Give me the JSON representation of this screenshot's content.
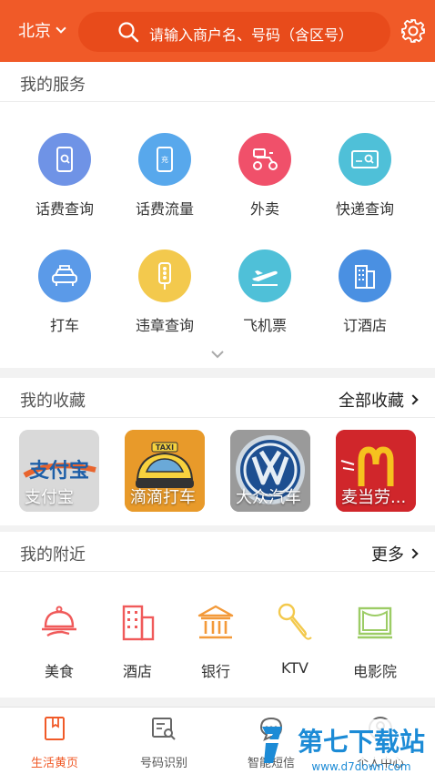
{
  "header": {
    "city": "北京",
    "search_placeholder": "请输入商户名、号码（含区号）"
  },
  "services": {
    "title": "我的服务",
    "items": [
      {
        "label": "话费查询",
        "icon": "phone-search-icon",
        "color": "#6f93e6"
      },
      {
        "label": "话费流量",
        "icon": "phone-charge-icon",
        "color": "#58a8ec"
      },
      {
        "label": "外卖",
        "icon": "scooter-icon",
        "color": "#f0506a"
      },
      {
        "label": "快递查询",
        "icon": "parcel-search-icon",
        "color": "#4fc0d8"
      },
      {
        "label": "打车",
        "icon": "car-icon",
        "color": "#5b9ae8"
      },
      {
        "label": "违章查询",
        "icon": "traffic-light-icon",
        "color": "#f3c94d"
      },
      {
        "label": "飞机票",
        "icon": "airplane-icon",
        "color": "#4fc0d8"
      },
      {
        "label": "订酒店",
        "icon": "hotel-building-icon",
        "color": "#4a90e2"
      }
    ]
  },
  "favorites": {
    "title": "我的收藏",
    "more": "全部收藏",
    "items": [
      {
        "label": "支付宝",
        "logo_text": "支付宝",
        "bg": "#d9d9d9"
      },
      {
        "label": "滴滴打车",
        "logo_text": "TAXI",
        "bg": "#e89a2a"
      },
      {
        "label": "大众汽车",
        "logo_text": "VW",
        "bg": "#9a9a9a"
      },
      {
        "label": "麦当劳...",
        "logo_text": "M",
        "bg": "#d0262b"
      }
    ]
  },
  "nearby": {
    "title": "我的附近",
    "more": "更多",
    "items": [
      {
        "label": "美食",
        "icon": "dining-cloche-icon",
        "color": "#f05a5a"
      },
      {
        "label": "酒店",
        "icon": "hotel-icon",
        "color": "#f05a5a"
      },
      {
        "label": "银行",
        "icon": "bank-icon",
        "color": "#f39a3a"
      },
      {
        "label": "KTV",
        "icon": "microphone-icon",
        "color": "#f3c94d"
      },
      {
        "label": "电影院",
        "icon": "cinema-screen-icon",
        "color": "#9ccc65"
      }
    ]
  },
  "bottom_nav": {
    "tabs": [
      {
        "label": "生活黄页",
        "active": true
      },
      {
        "label": "号码识别",
        "active": false
      },
      {
        "label": "智能短信",
        "active": false
      },
      {
        "label": "个人中心",
        "active": false
      }
    ]
  },
  "watermark": {
    "main": "第七下载站",
    "sub": "www.d7down.com"
  }
}
